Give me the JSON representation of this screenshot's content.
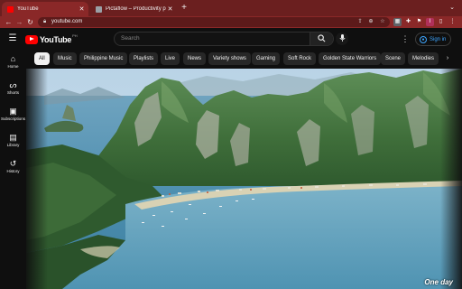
{
  "browser": {
    "tabs": [
      {
        "label": "YouTube",
        "active": true,
        "favicon_color": "#ff0000"
      },
      {
        "label": "Pictaflow – Productivity pictur...",
        "active": false,
        "favicon_color": "#9aa0a6"
      }
    ],
    "new_tab_icon": "plus-icon",
    "url": "youtube.com",
    "colors": {
      "tabbar": "#6b1f1f",
      "toolbar": "#8a2828",
      "omnibox": "#5c1a1a"
    }
  },
  "masthead": {
    "logo_text": "YouTube",
    "logo_superscript": "PH",
    "search_placeholder": "Search",
    "signin_label": "Sign in"
  },
  "guide": {
    "items": [
      {
        "label": "Home",
        "icon": "home-icon"
      },
      {
        "label": "Shorts",
        "icon": "shorts-icon"
      },
      {
        "label": "Subscriptions",
        "icon": "subscriptions-icon"
      },
      {
        "label": "Library",
        "icon": "library-icon"
      },
      {
        "label": "History",
        "icon": "history-icon"
      }
    ]
  },
  "chips": [
    "All",
    "Music",
    "Philippine Music",
    "Playlists",
    "Live",
    "News",
    "Variety shows",
    "Gaming",
    "Soft Rock",
    "Golden State Warriors",
    "Scene",
    "Melodies"
  ],
  "player": {
    "caption": "One day",
    "scene": "aerial-lagoon-limestone-cliffs"
  },
  "colors": {
    "brand_red": "#ff0000",
    "accent_blue": "#3ea6ff",
    "background": "#0f0f0f"
  }
}
